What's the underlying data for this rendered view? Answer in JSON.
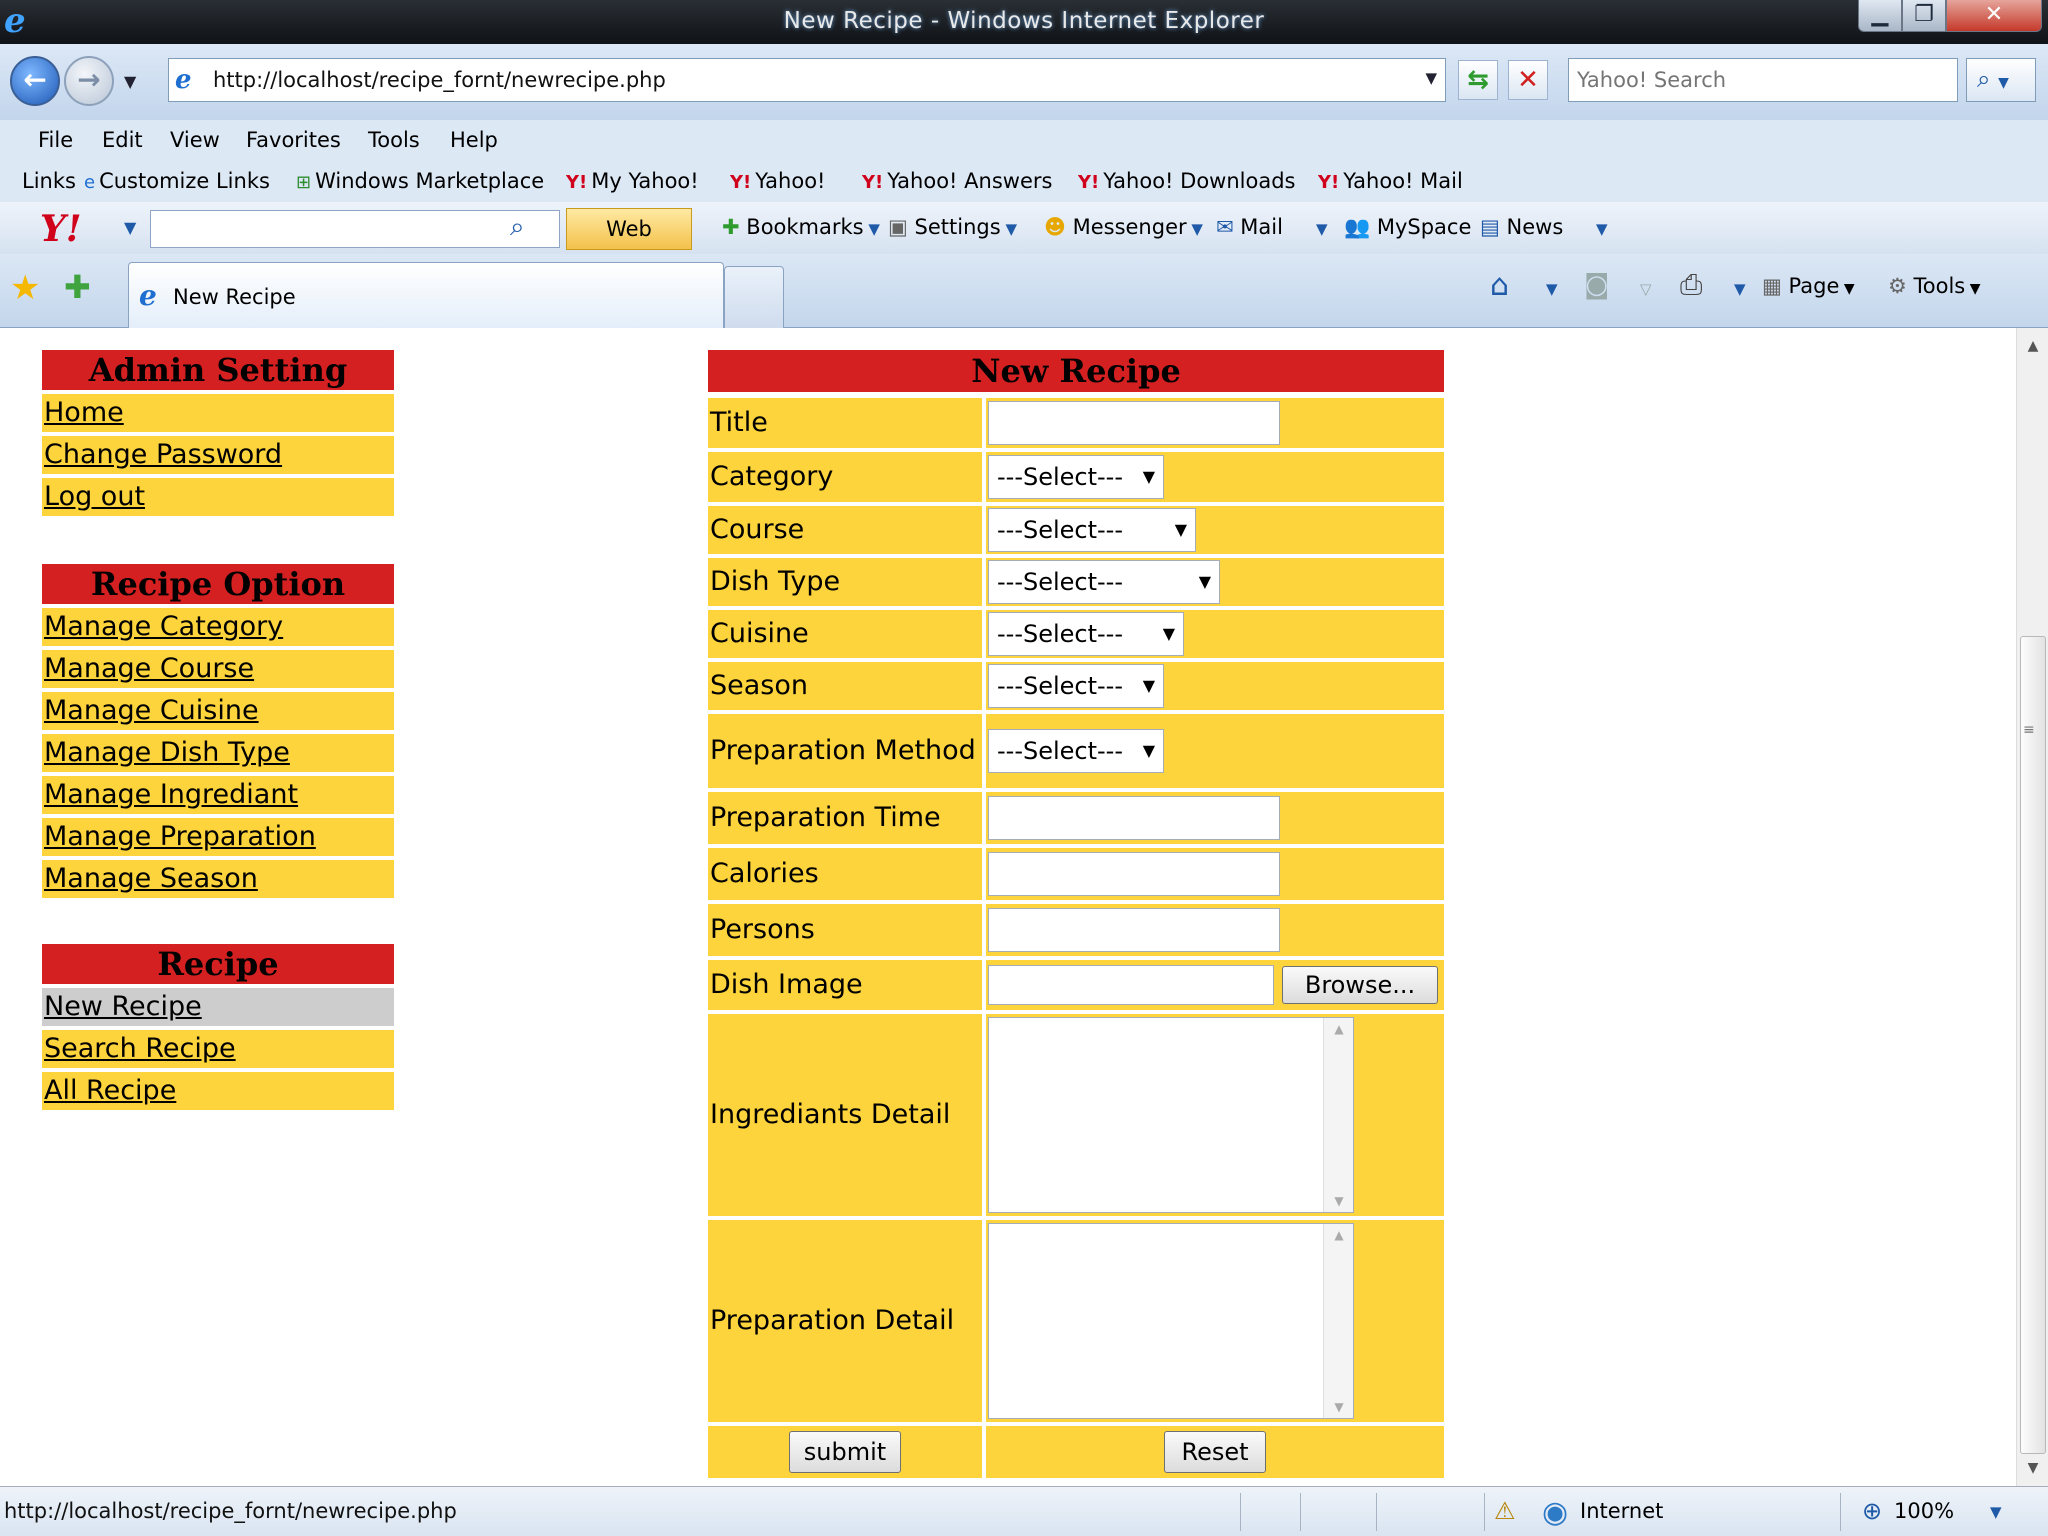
{
  "window": {
    "title": "New Recipe - Windows Internet Explorer",
    "minimize_glyph": "▁",
    "maximize_glyph": "❐",
    "close_glyph": "✕"
  },
  "address": {
    "url": "http://localhost/recipe_fornt/newrecipe.php",
    "search_placeholder": "Yahoo! Search"
  },
  "menu": [
    "File",
    "Edit",
    "View",
    "Favorites",
    "Tools",
    "Help"
  ],
  "links_bar": {
    "label": "Links",
    "items": [
      "Customize Links",
      "Windows Marketplace",
      "My Yahoo!",
      "Yahoo!",
      "Yahoo! Answers",
      "Yahoo! Downloads",
      "Yahoo! Mail"
    ]
  },
  "yahoo_toolbar": {
    "logo": "Y!",
    "web_search": "Web Search",
    "bookmarks": "Bookmarks",
    "settings": "Settings",
    "messenger": "Messenger",
    "mail": "Mail",
    "myspace": "MySpace",
    "news": "News"
  },
  "tabs": {
    "active": "New Recipe"
  },
  "command_bar": {
    "page": "Page",
    "tools": "Tools"
  },
  "sidebar": {
    "admin": {
      "heading": "Admin Setting",
      "links": [
        "Home",
        "Change Password",
        "Log out"
      ]
    },
    "recipe_option": {
      "heading": "Recipe Option",
      "links": [
        "Manage Category",
        "Manage Course",
        "Manage Cuisine",
        "Manage Dish Type",
        "Manage Ingrediant",
        "Manage Preparation",
        "Manage Season"
      ]
    },
    "recipe": {
      "heading": "Recipe",
      "links": [
        "New Recipe",
        "Search Recipe",
        "All Recipe"
      ],
      "current": "New Recipe"
    }
  },
  "form": {
    "heading": "New Recipe",
    "labels": {
      "title": "Title",
      "category": "Category",
      "course": "Course",
      "dish_type": "Dish Type",
      "cuisine": "Cuisine",
      "season": "Season",
      "preparation_method": "Preparation Method",
      "preparation_time": "Preparation Time",
      "calories": "Calories",
      "persons": "Persons",
      "dish_image": "Dish Image",
      "ingrediants_detail": "Ingrediants Detail",
      "preparation_detail": "Preparation Detail"
    },
    "select_placeholder": "---Select---",
    "browse": "Browse...",
    "submit": "submit",
    "reset": "Reset"
  },
  "status": {
    "text": "http://localhost/recipe_fornt/newrecipe.php",
    "zone": "Internet",
    "zoom": "100%"
  }
}
